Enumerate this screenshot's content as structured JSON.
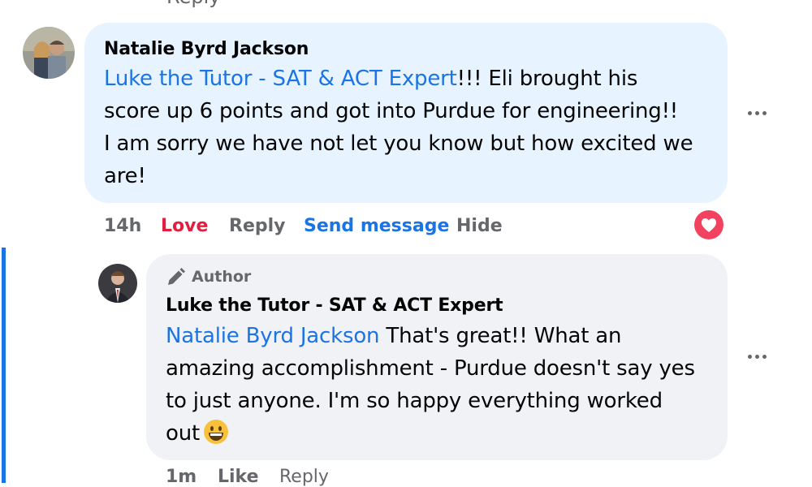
{
  "top": {
    "cut_text": "Reply"
  },
  "comment": {
    "author": "Natalie Byrd Jackson",
    "mention": "Luke the Tutor - SAT & ACT Expert",
    "line1_rest": "!!! Eli brought his",
    "line2": "score up 6 points and got into Purdue for engineering!!",
    "line3": "I am sorry we have not let you know but how excited we",
    "line4": "are!",
    "time": "14h",
    "love": "Love",
    "reply": "Reply",
    "send_message": "Send message",
    "hide": "Hide",
    "reaction_icon": "heart-reaction-icon",
    "more_icon": "more-options-icon"
  },
  "reply": {
    "badge": "Author",
    "author": "Luke the Tutor - SAT & ACT Expert",
    "mention": "Natalie Byrd Jackson",
    "line1_rest": " That's great!! What an",
    "line2": "amazing accomplishment - Purdue doesn't say yes",
    "line3": "to just anyone. I'm so happy everything worked",
    "line4": "out",
    "time": "1m",
    "like": "Like",
    "reply": "Reply",
    "emoji": "grinning-face-emoji",
    "more_icon": "more-options-icon"
  },
  "colors": {
    "comment_bubble": "#e7f3ff",
    "reply_bubble": "#f0f2f5",
    "link": "#1b74e4",
    "love": "#e41e3f",
    "muted": "#65676b"
  }
}
